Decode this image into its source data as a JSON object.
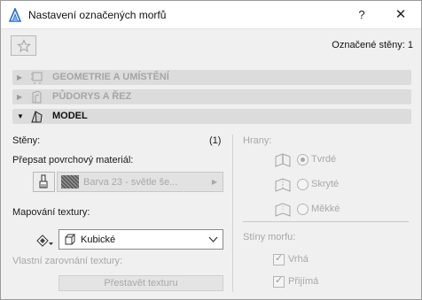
{
  "window": {
    "title": "Nastavení označených morfů",
    "help_label": "?",
    "close_label": "✕"
  },
  "toolbar": {
    "favorites_icon": "star-icon",
    "selected_label": "Označené stěny: 1"
  },
  "sections": [
    {
      "label": "GEOMETRIE A UMÍSTĚNÍ",
      "icon": "geometry-icon",
      "expanded": false
    },
    {
      "label": "PŮDORYS A ŘEZ",
      "icon": "floorplan-icon",
      "expanded": false
    },
    {
      "label": "MODEL",
      "icon": "model-icon",
      "expanded": true
    }
  ],
  "model": {
    "walls_label": "Stěny:",
    "walls_count": "(1)",
    "override_label": "Přepsat povrchový materiál:",
    "material_value": "Barva 23 - světle še...",
    "texture_mapping_label": "Mapování textury:",
    "texture_mapping_value": "Kubické",
    "custom_alignment_label": "Vlastní zarovnání textury:",
    "rebuild_button": "Přestavět texturu",
    "edges_label": "Hrany:",
    "edges_options": [
      {
        "label": "Tvrdé",
        "checked": true
      },
      {
        "label": "Skryté",
        "checked": false
      },
      {
        "label": "Měkké",
        "checked": false
      }
    ],
    "shadows_label": "Stíny morfu:",
    "shadow_options": [
      {
        "label": "Vrhá",
        "checked": true
      },
      {
        "label": "Přijímá",
        "checked": true
      }
    ]
  },
  "colors": {
    "section_bar": "#dcdcdc",
    "disabled_text": "#a8a8a8",
    "window_bg": "#f0f0f0"
  }
}
